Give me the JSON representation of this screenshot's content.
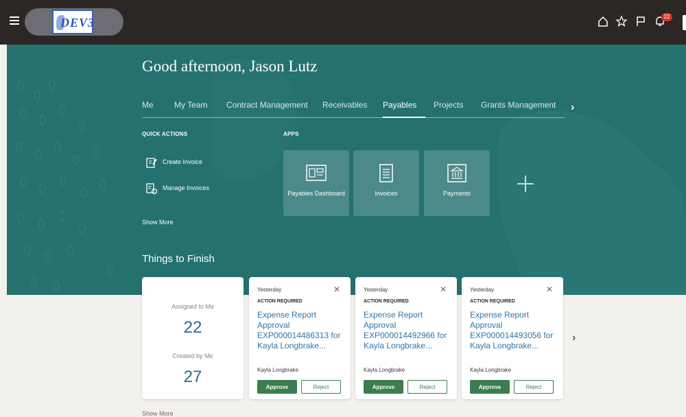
{
  "header": {
    "logo_text": "DEV3",
    "notifications_count": "22"
  },
  "greeting": "Good afternoon, Jason Lutz",
  "tabs": [
    "Me",
    "My Team",
    "Contract Management",
    "Receivables",
    "Payables",
    "Projects",
    "Grants Management"
  ],
  "active_tab": "Payables",
  "quick_actions": {
    "heading": "QUICK ACTIONS",
    "items": [
      {
        "label": "Create Invoice",
        "icon": "create-invoice-icon"
      },
      {
        "label": "Manage Invoices",
        "icon": "manage-invoices-icon"
      }
    ],
    "show_more": "Show More"
  },
  "apps": {
    "heading": "APPS",
    "tiles": [
      {
        "label": "Payables Dashboard",
        "icon": "dashboard-icon"
      },
      {
        "label": "Invoices",
        "icon": "document-icon"
      },
      {
        "label": "Payments",
        "icon": "bank-icon"
      }
    ]
  },
  "things_to_finish": {
    "title": "Things to Finish",
    "assigned_label": "Assigned to Me",
    "assigned_count": "22",
    "created_label": "Created by Me",
    "created_count": "27",
    "cards": [
      {
        "date": "Yesterday",
        "status": "ACTION REQUIRED",
        "title": "Expense Report Approval EXP000014486313 for Kayla Longbrake...",
        "person": "Kayla Longbrake",
        "approve": "Approve",
        "reject": "Reject"
      },
      {
        "date": "Yesterday",
        "status": "ACTION REQUIRED",
        "title": "Expense Report Approval EXP000014492966 for Kayla Longbrake...",
        "person": "Kayla Longbrake",
        "approve": "Approve",
        "reject": "Reject"
      },
      {
        "date": "Yesterday",
        "status": "ACTION REQUIRED",
        "title": "Expense Report Approval EXP000014493056 for Kayla Longbrake...",
        "person": "Kayla Longbrake",
        "approve": "Approve",
        "reject": "Reject"
      }
    ],
    "show_more": "Show More"
  },
  "colors": {
    "header_bg": "#2c2624",
    "hero_bg": "#24716f",
    "approve_green": "#3a7d4e",
    "link_blue": "#3174a6",
    "badge_red": "#d8332a"
  }
}
